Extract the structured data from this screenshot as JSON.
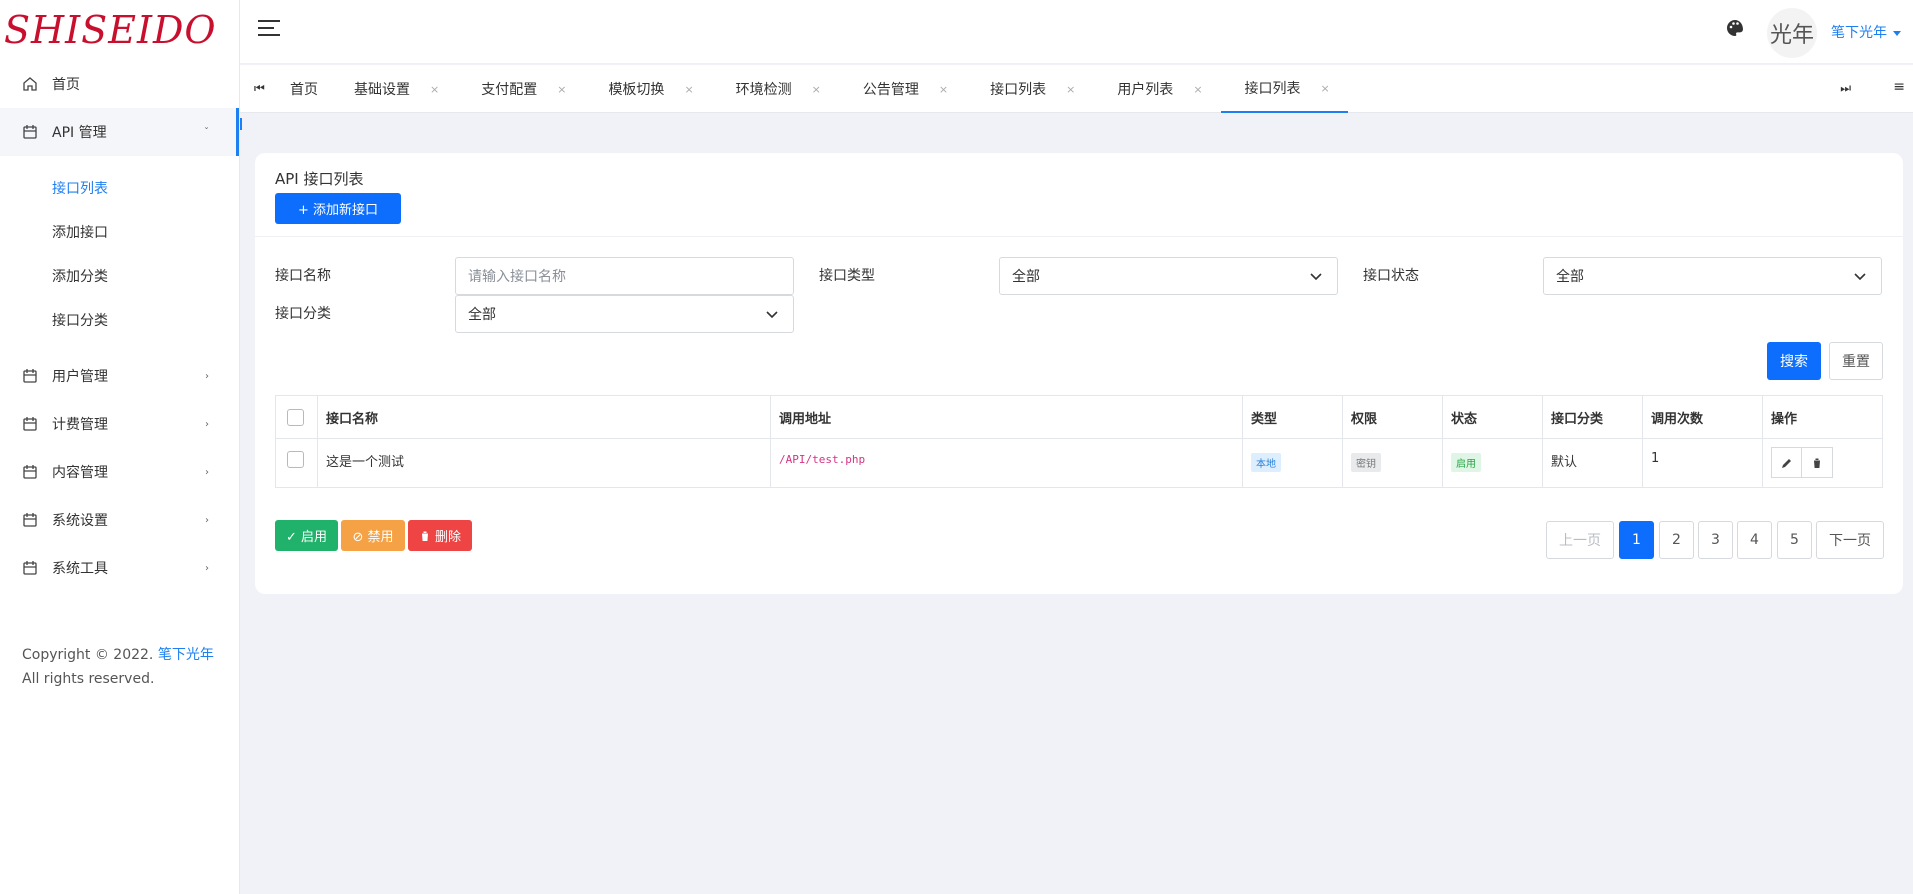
{
  "brand": {
    "logo_text": "SHISEIDO"
  },
  "sidebar": {
    "items": [
      {
        "label": "首页",
        "icon": "home-icon",
        "has_arrow": false
      },
      {
        "label": "API 管理",
        "icon": "calendar-icon",
        "arrow": "ˇ"
      }
    ],
    "sub_items": [
      {
        "label": "接口列表",
        "active": true
      },
      {
        "label": "添加接口"
      },
      {
        "label": "添加分类"
      },
      {
        "label": "接口分类"
      }
    ],
    "more_items": [
      {
        "label": "用户管理",
        "arrow": "›"
      },
      {
        "label": "计费管理",
        "arrow": "›"
      },
      {
        "label": "内容管理",
        "arrow": "›"
      },
      {
        "label": "系统设置",
        "arrow": "›"
      },
      {
        "label": "系统工具",
        "arrow": "›"
      }
    ],
    "copyright_prefix": "Copyright © 2022.",
    "copyright_link": "笔下光年",
    "copyright_suffix": "All rights reserved."
  },
  "header": {
    "username": "笔下光年",
    "avatar_text": "光年"
  },
  "tabs": {
    "prev_symbol": "⏮",
    "next_symbol": "⏭",
    "menu_symbol": "≡",
    "close_symbol": "×",
    "items": [
      {
        "label": "首页"
      },
      {
        "label": "基础设置"
      },
      {
        "label": "支付配置"
      },
      {
        "label": "模板切换"
      },
      {
        "label": "环境检测"
      },
      {
        "label": "公告管理"
      },
      {
        "label": "接口列表"
      },
      {
        "label": "用户列表"
      },
      {
        "label": "接口列表",
        "active": true
      }
    ]
  },
  "card": {
    "title": "API 接口列表",
    "add_button": "+ 添加新接口"
  },
  "filters": {
    "name_label": "接口名称",
    "name_placeholder": "请输入接口名称",
    "type_label": "接口类型",
    "type_value": "全部",
    "status_label": "接口状态",
    "status_value": "全部",
    "category_label": "接口分类",
    "category_value": "全部",
    "search_button": "搜索",
    "reset_button": "重置"
  },
  "table": {
    "headers": [
      "接口名称",
      "调用地址",
      "类型",
      "权限",
      "状态",
      "接口分类",
      "调用次数",
      "操作"
    ],
    "rows": [
      {
        "name": "这是一个测试",
        "url": "/API/test.php",
        "type": "本地",
        "permission": "密钥",
        "status": "启用",
        "category": "默认",
        "calls": "1"
      }
    ]
  },
  "bulk_actions": {
    "enable": "✓ 启用",
    "disable": "⊘ 禁用",
    "delete": "删除"
  },
  "pagination": {
    "prev": "上一页",
    "pages": [
      "1",
      "2",
      "3",
      "4",
      "5"
    ],
    "current": "1",
    "next": "下一页"
  },
  "colors": {
    "primary": "#0d6efd",
    "brand": "#c8102e",
    "success": "#20b26b",
    "warning": "#f5a246",
    "danger": "#ee4444"
  }
}
